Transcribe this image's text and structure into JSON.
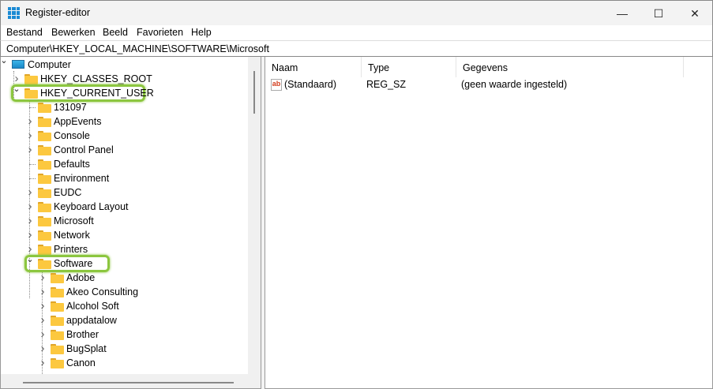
{
  "window": {
    "title": "Register-editor",
    "minimize": "—",
    "maximize": "☐",
    "close": "✕"
  },
  "menu": [
    "Bestand",
    "Bewerken",
    "Beeld",
    "Favorieten",
    "Help"
  ],
  "address": "Computer\\HKEY_LOCAL_MACHINE\\SOFTWARE\\Microsoft",
  "tree": [
    {
      "label": "Computer",
      "level": 0,
      "icon": "computer",
      "state": "expanded"
    },
    {
      "label": "HKEY_CLASSES_ROOT",
      "level": 1,
      "state": "collapsed"
    },
    {
      "label": "HKEY_CURRENT_USER",
      "level": 1,
      "state": "expanded",
      "highlighted": true
    },
    {
      "label": "131097",
      "level": 2,
      "state": "leaf"
    },
    {
      "label": "AppEvents",
      "level": 2,
      "state": "collapsed"
    },
    {
      "label": "Console",
      "level": 2,
      "state": "collapsed"
    },
    {
      "label": "Control Panel",
      "level": 2,
      "state": "collapsed"
    },
    {
      "label": "Defaults",
      "level": 2,
      "state": "leaf"
    },
    {
      "label": "Environment",
      "level": 2,
      "state": "leaf"
    },
    {
      "label": "EUDC",
      "level": 2,
      "state": "collapsed"
    },
    {
      "label": "Keyboard Layout",
      "level": 2,
      "state": "collapsed"
    },
    {
      "label": "Microsoft",
      "level": 2,
      "state": "collapsed"
    },
    {
      "label": "Network",
      "level": 2,
      "state": "collapsed"
    },
    {
      "label": "Printers",
      "level": 2,
      "state": "collapsed"
    },
    {
      "label": "Software",
      "level": 2,
      "state": "expanded",
      "highlighted": true
    },
    {
      "label": "Adobe",
      "level": 3,
      "state": "collapsed"
    },
    {
      "label": "Akeo Consulting",
      "level": 3,
      "state": "collapsed"
    },
    {
      "label": "Alcohol Soft",
      "level": 3,
      "state": "collapsed"
    },
    {
      "label": "appdatalow",
      "level": 3,
      "state": "collapsed"
    },
    {
      "label": "Brother",
      "level": 3,
      "state": "collapsed"
    },
    {
      "label": "BugSplat",
      "level": 3,
      "state": "collapsed"
    },
    {
      "label": "Canon",
      "level": 3,
      "state": "collapsed"
    }
  ],
  "list": {
    "columns": [
      "Naam",
      "Type",
      "Gegevens"
    ],
    "rows": [
      {
        "name": "(Standaard)",
        "type": "REG_SZ",
        "data": "(geen waarde ingesteld)",
        "icon": "ab"
      }
    ]
  },
  "highlight_color": "#8cc63f"
}
